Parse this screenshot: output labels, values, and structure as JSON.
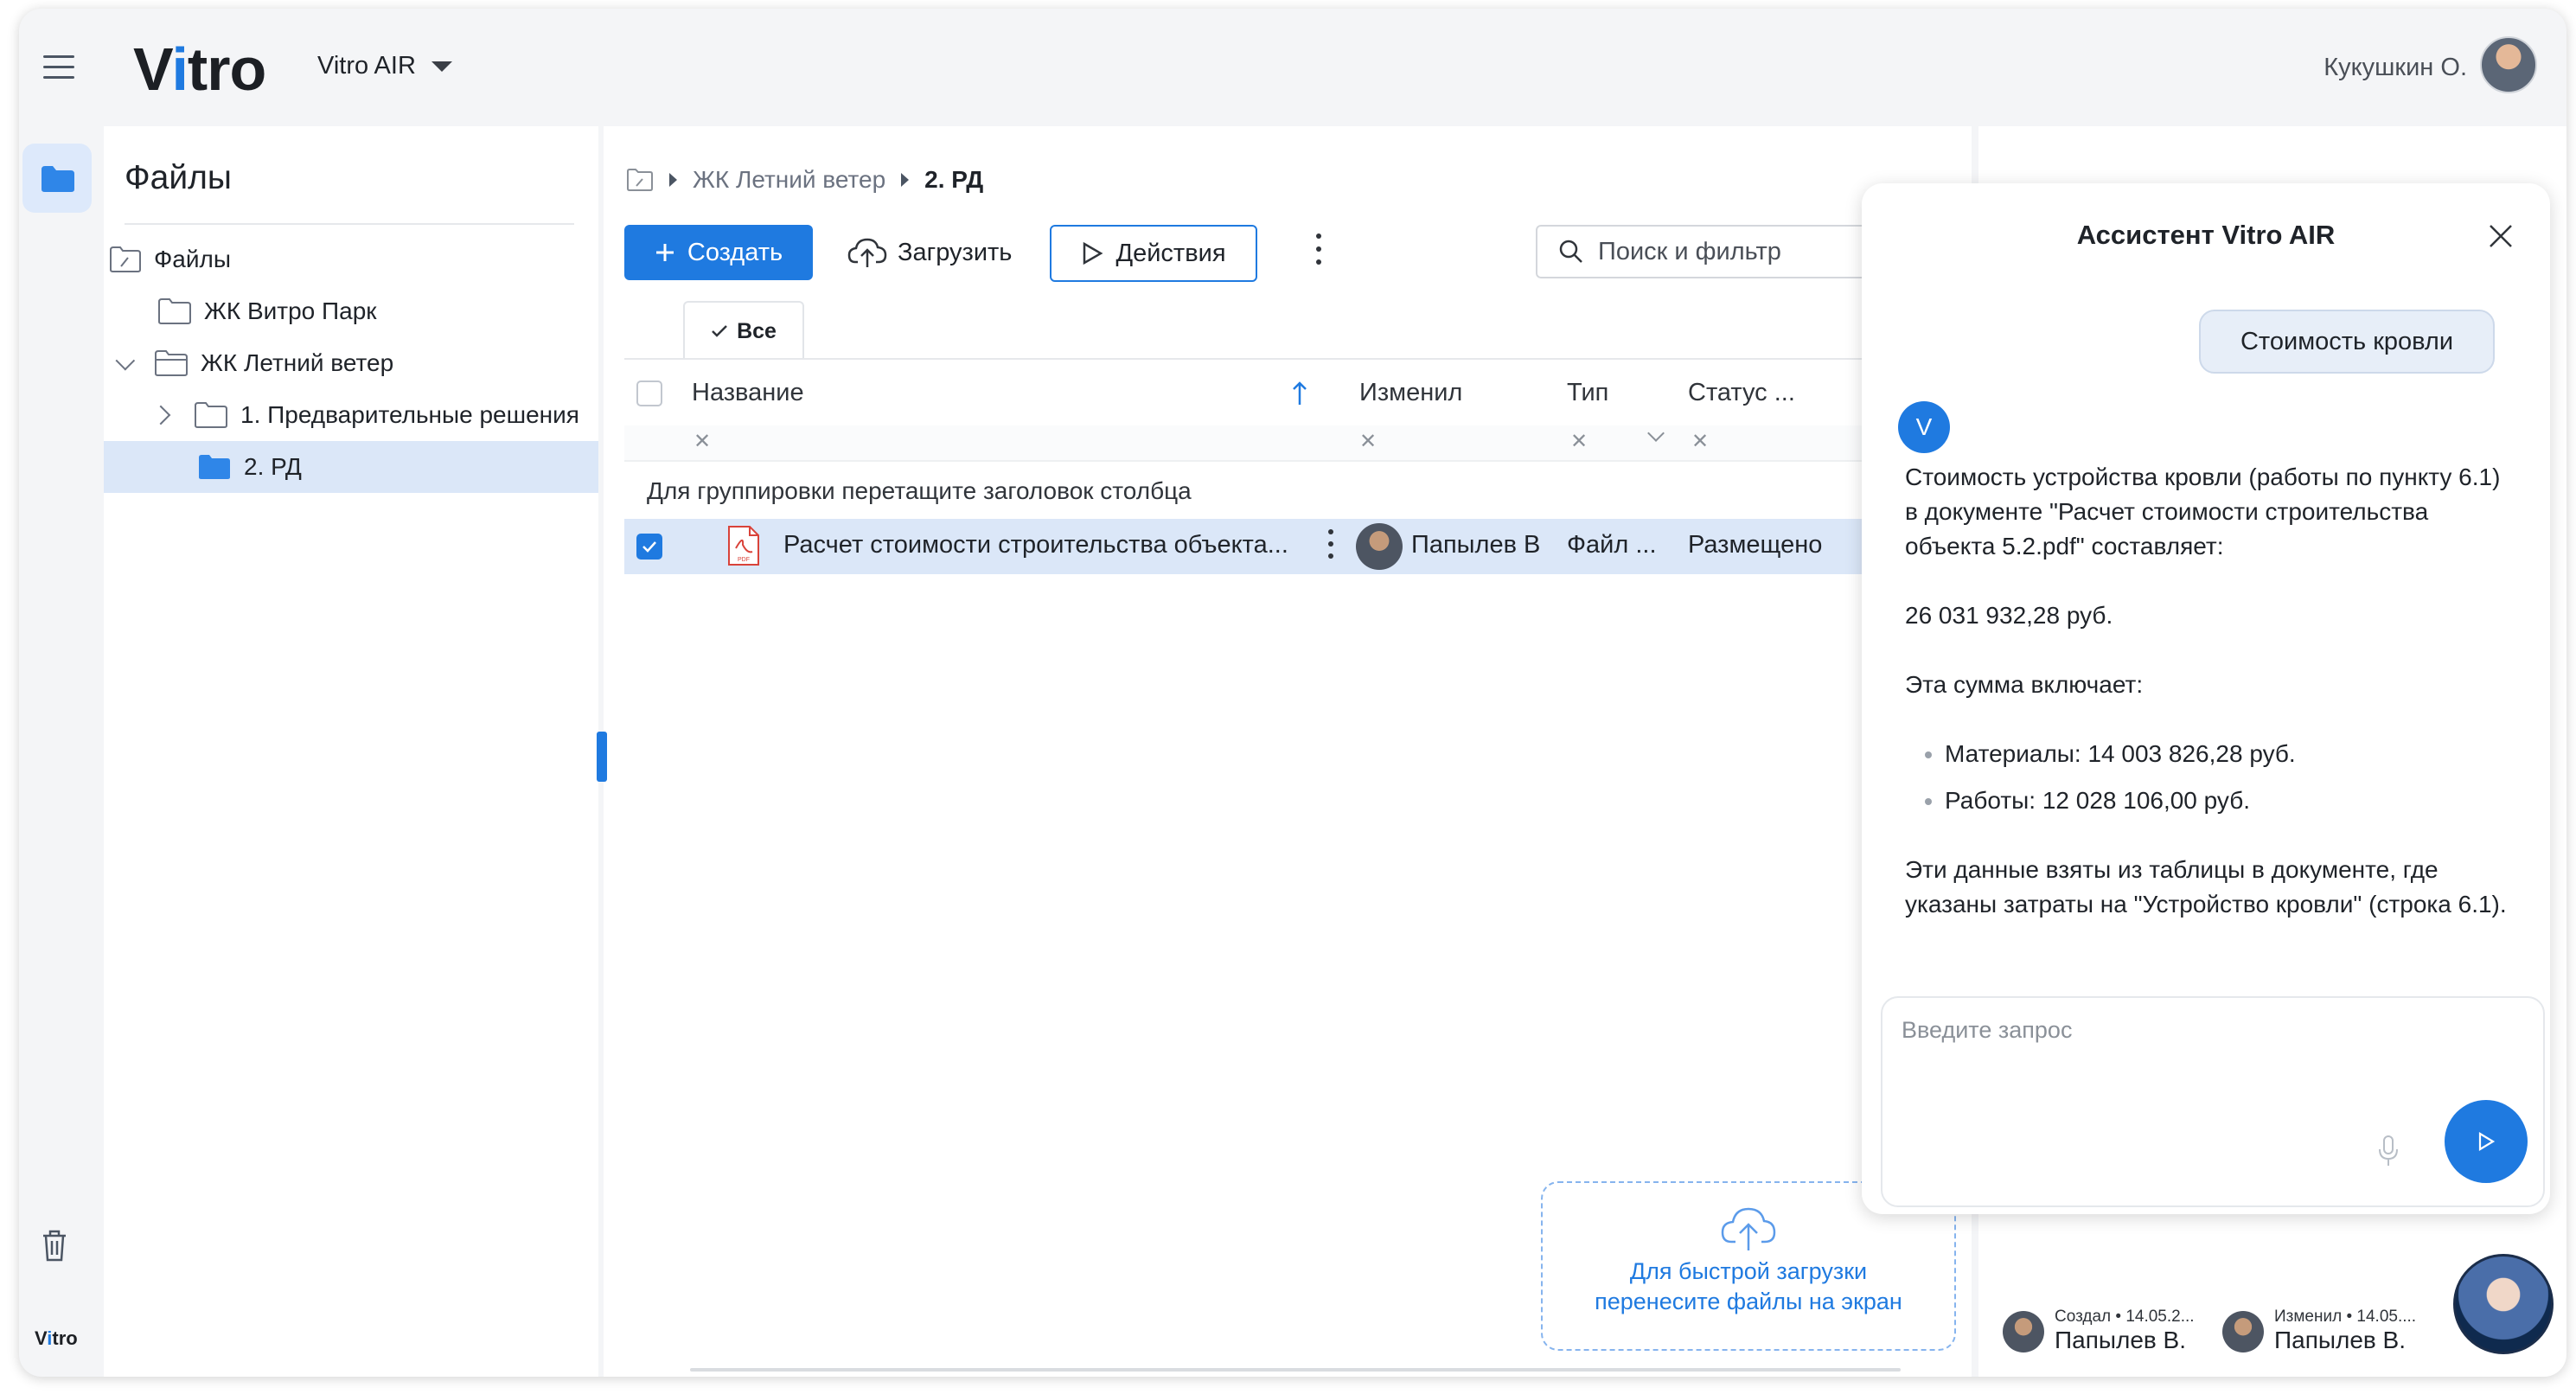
{
  "header": {
    "logo_pre": "V",
    "logo_i": "i",
    "logo_post": "tro",
    "project": "Vitro AIR",
    "user_name": "Кукушкин О."
  },
  "rail": {
    "bottom_logo_pre": "V",
    "bottom_logo_i": "i",
    "bottom_logo_post": "tro"
  },
  "tree": {
    "title": "Файлы",
    "items": [
      {
        "label": "Файлы"
      },
      {
        "label": "ЖК Витро Парк"
      },
      {
        "label": "ЖК Летний ветер"
      },
      {
        "label": "1. Предварительные решения"
      },
      {
        "label": "2. РД"
      }
    ]
  },
  "breadcrumb": {
    "parent": "ЖК Летний ветер",
    "current": "2. РД"
  },
  "toolbar": {
    "create": "Создать",
    "upload": "Загрузить",
    "actions": "Действия",
    "search_placeholder": "Поиск и фильтр"
  },
  "tabs": {
    "all": "Все"
  },
  "grid": {
    "columns": {
      "name": "Название",
      "changed": "Изменил",
      "type": "Тип",
      "status": "Статус ..."
    },
    "group_hint": "Для группировки перетащите заголовок столбца",
    "rows": [
      {
        "name": "Расчет стоимости строительства объекта...",
        "changed_by": "Папылев В",
        "type": "Файл ...",
        "status": "Размещено"
      }
    ]
  },
  "drop_zone": {
    "line1": "Для быстрой загрузки",
    "line2": "перенесите файлы на экран"
  },
  "right_panel": {
    "created_label": "Создал",
    "created_date": "14.05.2...",
    "created_by": "Папылев В.",
    "changed_label": "Изменил",
    "changed_date": "14.05....",
    "changed_by": "Папылев В."
  },
  "assistant": {
    "title": "Ассистент Vitro AIR",
    "user_message": "Стоимость кровли",
    "bot_initial": "V",
    "answer_intro": "Стоимость устройства кровли (работы по пункту 6.1) в документе \"Расчет стоимости строительства объекта 5.2.pdf\" составляет:",
    "answer_total": "26 031 932,28 руб.",
    "answer_includes": "Эта сумма включает:",
    "answer_items": [
      "Материалы: 14 003 826,28 руб.",
      "Работы: 12 028 106,00 руб."
    ],
    "answer_source": "Эти данные взяты из таблицы в документе, где указаны затраты на \"Устройство кровли\" (строка 6.1).",
    "input_placeholder": "Введите запрос"
  },
  "colors": {
    "accent": "#1f7ae0",
    "selection": "#dbe7f8",
    "background": "#f4f5f7"
  }
}
